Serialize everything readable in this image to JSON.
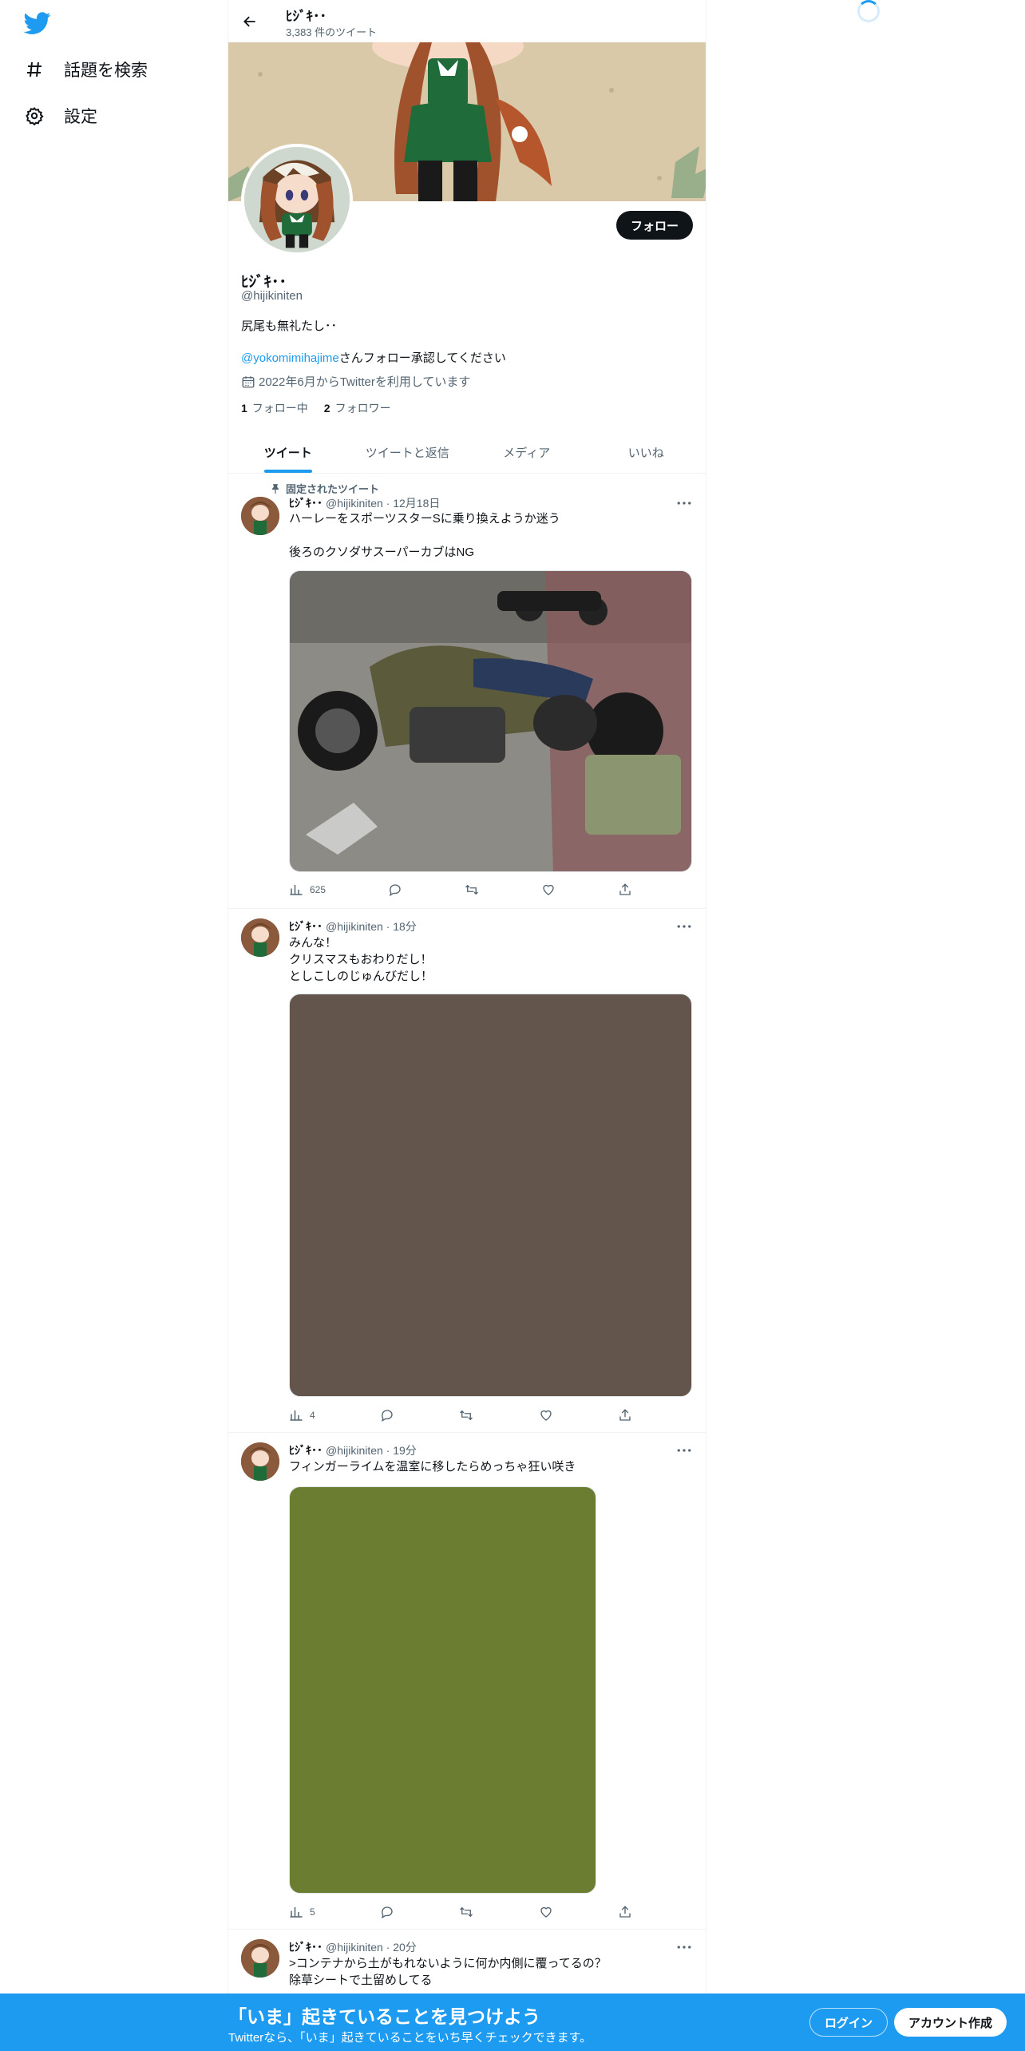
{
  "nav": {
    "items": [
      {
        "label": "話題を検索",
        "icon": "hashtag-icon"
      },
      {
        "label": "設定",
        "icon": "gear-icon"
      }
    ]
  },
  "header": {
    "title": "ﾋｼﾞｷ･･",
    "tweet_count": "3,383 件のツイート"
  },
  "profile": {
    "name": "ﾋｼﾞｷ･･",
    "handle": "@hijikiniten",
    "bio": "尻尾も無礼たし･･",
    "mention": "@yokomimihajime",
    "mention_suffix": "さんフォロー承認してください",
    "joined": "2022年6月からTwitterを利用しています",
    "following_count": "1",
    "following_label": "フォロー中",
    "followers_count": "2",
    "followers_label": "フォロワー",
    "follow_button": "フォロー"
  },
  "tabs": [
    {
      "label": "ツイート",
      "active": true
    },
    {
      "label": "ツイートと返信",
      "active": false
    },
    {
      "label": "メディア",
      "active": false
    },
    {
      "label": "いいね",
      "active": false
    }
  ],
  "tweets": [
    {
      "pinned_label": "固定されたツイート",
      "name": "ﾋｼﾞｷ･･",
      "meta": "@hijikiniten · 12月18日",
      "text": "ハーレーをスポーツスターSに乗り換えようか迷う\n\n後ろのクソダサスーパーカブはNG",
      "views": "625",
      "media_color": "#6f6a58"
    },
    {
      "name": "ﾋｼﾞｷ･･",
      "meta": "@hijikiniten · 18分",
      "text": "みんな！\nクリスマスもおわりだし！\nとしこしのじゅんびだし！",
      "views": "4",
      "media_color": "#63544c"
    },
    {
      "name": "ﾋｼﾞｷ･･",
      "meta": "@hijikiniten · 19分",
      "text": "フィンガーライムを温室に移したらめっちゃ狂い咲き",
      "views": "5",
      "media_color": "#6a7d31"
    },
    {
      "name": "ﾋｼﾞｷ･･",
      "meta": "@hijikiniten · 20分",
      "text": ">コンテナから土がもれないように何か内側に覆ってるの？\n除草シートで土留めしてる"
    }
  ],
  "bottom_bar": {
    "title": "「いま」起きていることを見つけよう",
    "subtitle": "Twitterなら、「いま」起きていることをいち早くチェックできます。",
    "login": "ログイン",
    "signup": "アカウント作成"
  },
  "colors": {
    "accent": "#1d9bf0",
    "text": "#0f1419",
    "secondary": "#536471"
  }
}
